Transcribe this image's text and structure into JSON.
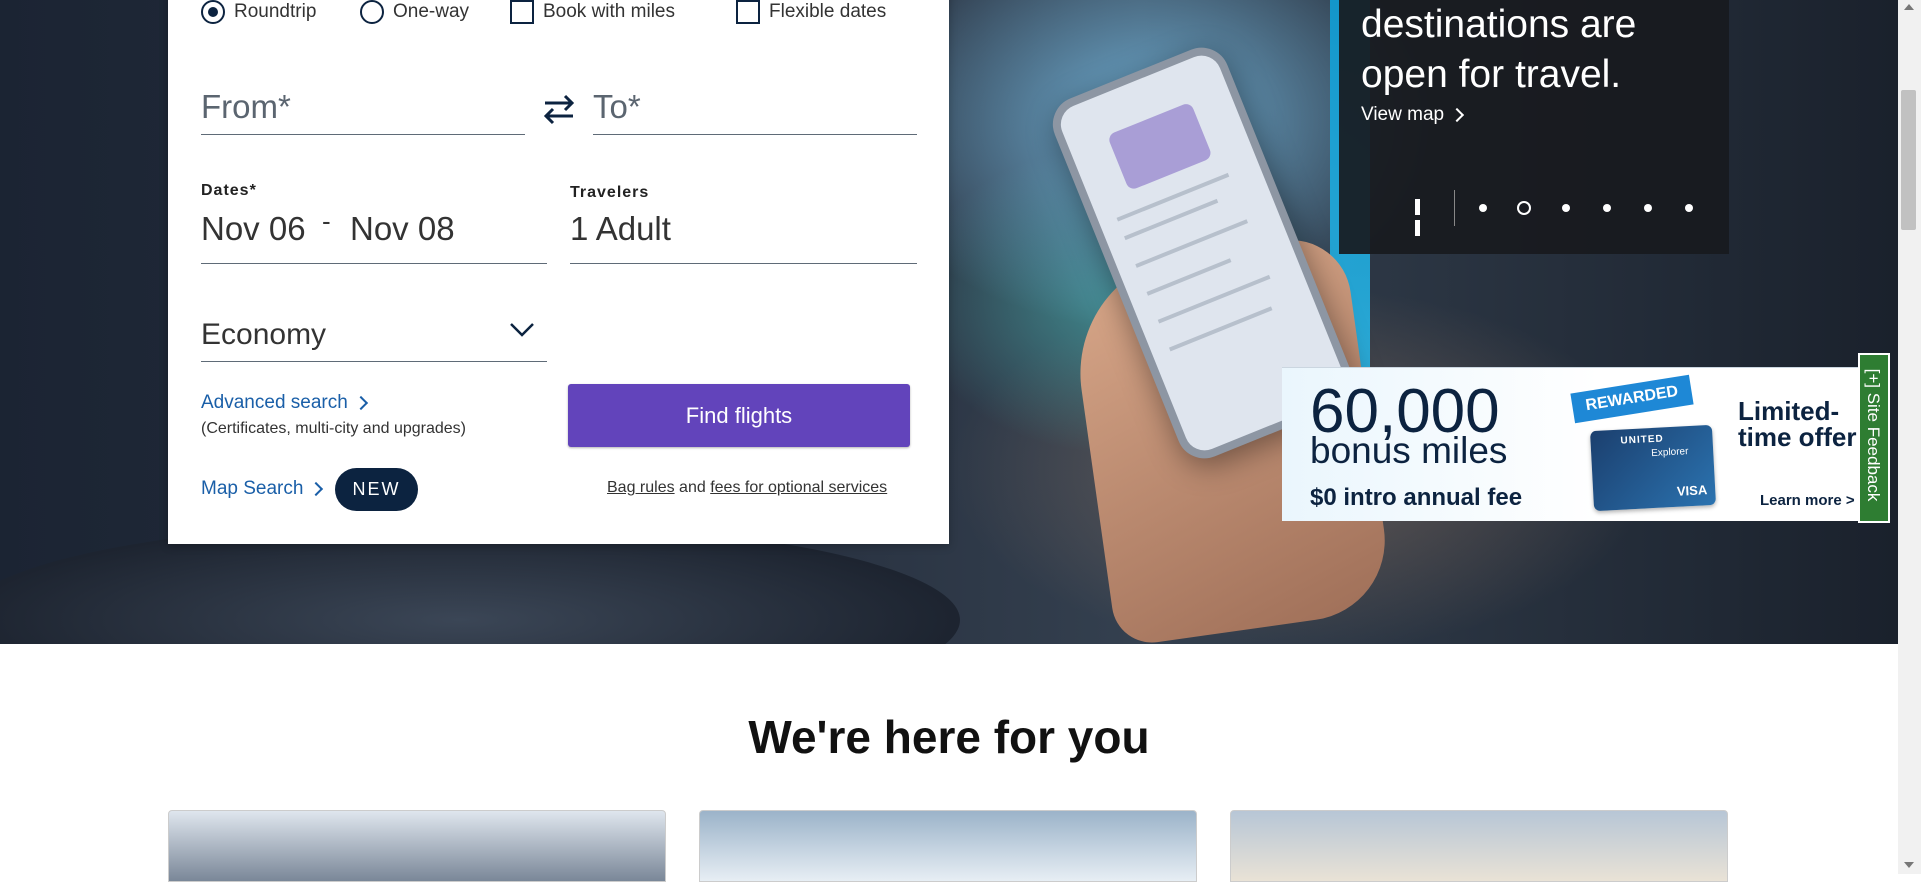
{
  "trip_options": {
    "roundtrip": "Roundtrip",
    "oneway": "One-way",
    "miles": "Book with miles",
    "flexible": "Flexible dates"
  },
  "search": {
    "from_placeholder": "From*",
    "to_placeholder": "To*",
    "dates_label": "Dates*",
    "date_start": "Nov 06",
    "date_separator": "-",
    "date_end": "Nov 08",
    "travelers_label": "Travelers",
    "travelers_value": "1 Adult",
    "cabin_value": "Economy",
    "advanced_search": "Advanced search",
    "advanced_sub": "(Certificates, multi-city and upgrades)",
    "map_search": "Map Search",
    "new_badge": "NEW",
    "find_button": "Find flights",
    "bag_rules": "Bag rules",
    "and": "and",
    "fees": "fees for optional services"
  },
  "carousel": {
    "heading_line1": "destinations are",
    "heading_line2": "open for travel.",
    "view_map": "View map"
  },
  "ad": {
    "amount": "60,000",
    "subtitle": "bonus miles",
    "fee": "$0 intro annual fee",
    "ribbon": "REWARDED",
    "card_brand": "UNITED",
    "card_name": "Explorer",
    "card_network": "VISA",
    "offer_line1": "Limited-",
    "offer_line2": "time offer",
    "learn_more": "Learn more >"
  },
  "feedback": {
    "label": "[+] Site Feedback"
  },
  "section": {
    "title": "We're here for you"
  },
  "colors": {
    "primary_purple": "#6244bb",
    "navy": "#0c2340",
    "link_blue": "#1a5fa8",
    "feedback_green": "#2e7d32"
  }
}
